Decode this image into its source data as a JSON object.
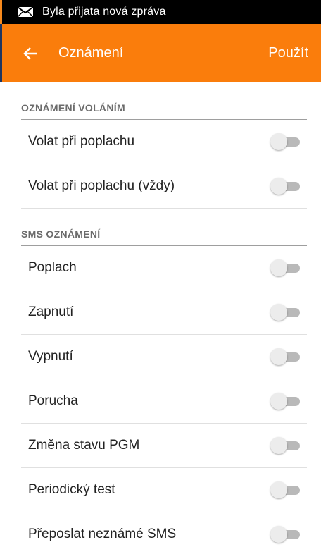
{
  "status_bar": {
    "notification": "Byla přijata nová zpráva",
    "icon": "mail-icon"
  },
  "app_bar": {
    "title": "Oznámení",
    "action": "Použít",
    "back_icon": "arrow-back-icon",
    "color": "#fa7d0c"
  },
  "sections": [
    {
      "header": "OZNÁMENÍ VOLÁNÍM",
      "items": [
        {
          "label": "Volat při poplachu",
          "enabled": false
        },
        {
          "label": "Volat při poplachu (vždy)",
          "enabled": false
        }
      ]
    },
    {
      "header": "SMS OZNÁMENÍ",
      "items": [
        {
          "label": "Poplach",
          "enabled": false
        },
        {
          "label": "Zapnutí",
          "enabled": false
        },
        {
          "label": "Vypnutí",
          "enabled": false
        },
        {
          "label": "Porucha",
          "enabled": false
        },
        {
          "label": "Změna stavu PGM",
          "enabled": false
        },
        {
          "label": "Periodický test",
          "enabled": false
        },
        {
          "label": "Přeposlat neznámé SMS",
          "enabled": false
        }
      ]
    }
  ]
}
